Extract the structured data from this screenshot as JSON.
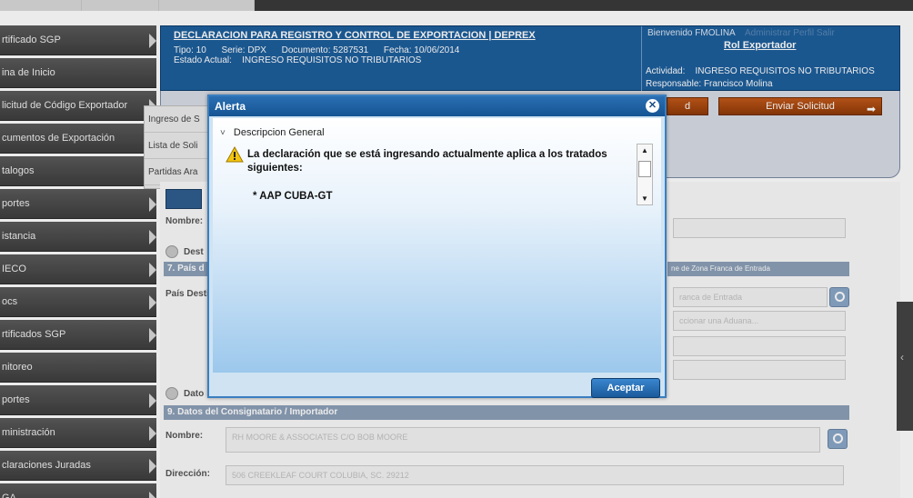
{
  "sidebar": {
    "items": [
      {
        "label": "rtificado SGP"
      },
      {
        "label": "ina de Inicio"
      },
      {
        "label": "licitud de Código Exportador"
      },
      {
        "label": "cumentos de Exportación"
      },
      {
        "label": "talogos"
      },
      {
        "label": "portes"
      },
      {
        "label": "istancia"
      },
      {
        "label": "IECO"
      },
      {
        "label": "ocs"
      },
      {
        "label": "rtificados SGP"
      },
      {
        "label": "nitoreo"
      },
      {
        "label": "portes"
      },
      {
        "label": "ministración"
      },
      {
        "label": "claraciones Juradas"
      },
      {
        "label": "GA"
      }
    ]
  },
  "flyout": {
    "items": [
      "Ingreso de S",
      "Lista de Soli",
      "Partidas Ara"
    ]
  },
  "header": {
    "title": "DECLARACION PARA REGISTRO Y CONTROL DE EXPORTACION | DEPREX",
    "tipo_label": "Tipo:",
    "tipo_value": "10",
    "serie_label": "Serie:",
    "serie_value": "DPX",
    "documento_label": "Documento:",
    "documento_value": "5287531",
    "fecha_label": "Fecha:",
    "fecha_value": "10/06/2014",
    "estado_label": "Estado Actual:",
    "estado_value": "INGRESO REQUISITOS NO TRIBUTARIOS",
    "welcome": "Bienvenido FMOLINA",
    "welcome_faint": "Administrar Perfil  Salir",
    "role": "Rol Exportador",
    "actividad_label": "Actividad:",
    "actividad_value": "INGRESO REQUISITOS NO TRIBUTARIOS",
    "responsable_label": "Responsable:",
    "responsable_value": "Francisco Molina"
  },
  "actions": {
    "send_label": "Enviar Solicitud",
    "left_partial": "d"
  },
  "form": {
    "nombre_label": "Nombre:",
    "dest_label": "Dest",
    "section7": "7. País d",
    "section7_right": "ne de Zona Franca de Entrada",
    "pais_label": "País Desti",
    "zona_placeholder": "ranca de Entrada",
    "aduana_placeholder": "ccionar una Aduana...",
    "datos_label": "Dato",
    "section9": "9. Datos del Consignatario / Importador",
    "nombre2_label": "Nombre:",
    "nombre2_value": "RH MOORE & ASSOCIATES C/O BOB MOORE",
    "direccion_label": "Dirección:",
    "direccion_value": "506 CREEKLEAF COURT COLUBIA, SC. 29212"
  },
  "modal": {
    "title": "Alerta",
    "close_glyph": "✕",
    "group_title": "Descripcion General",
    "message": "La declaración que se está ingresando actualmente aplica a los tratados siguientes:",
    "treaty": "* AAP CUBA-GT",
    "accept_label": "Aceptar"
  }
}
